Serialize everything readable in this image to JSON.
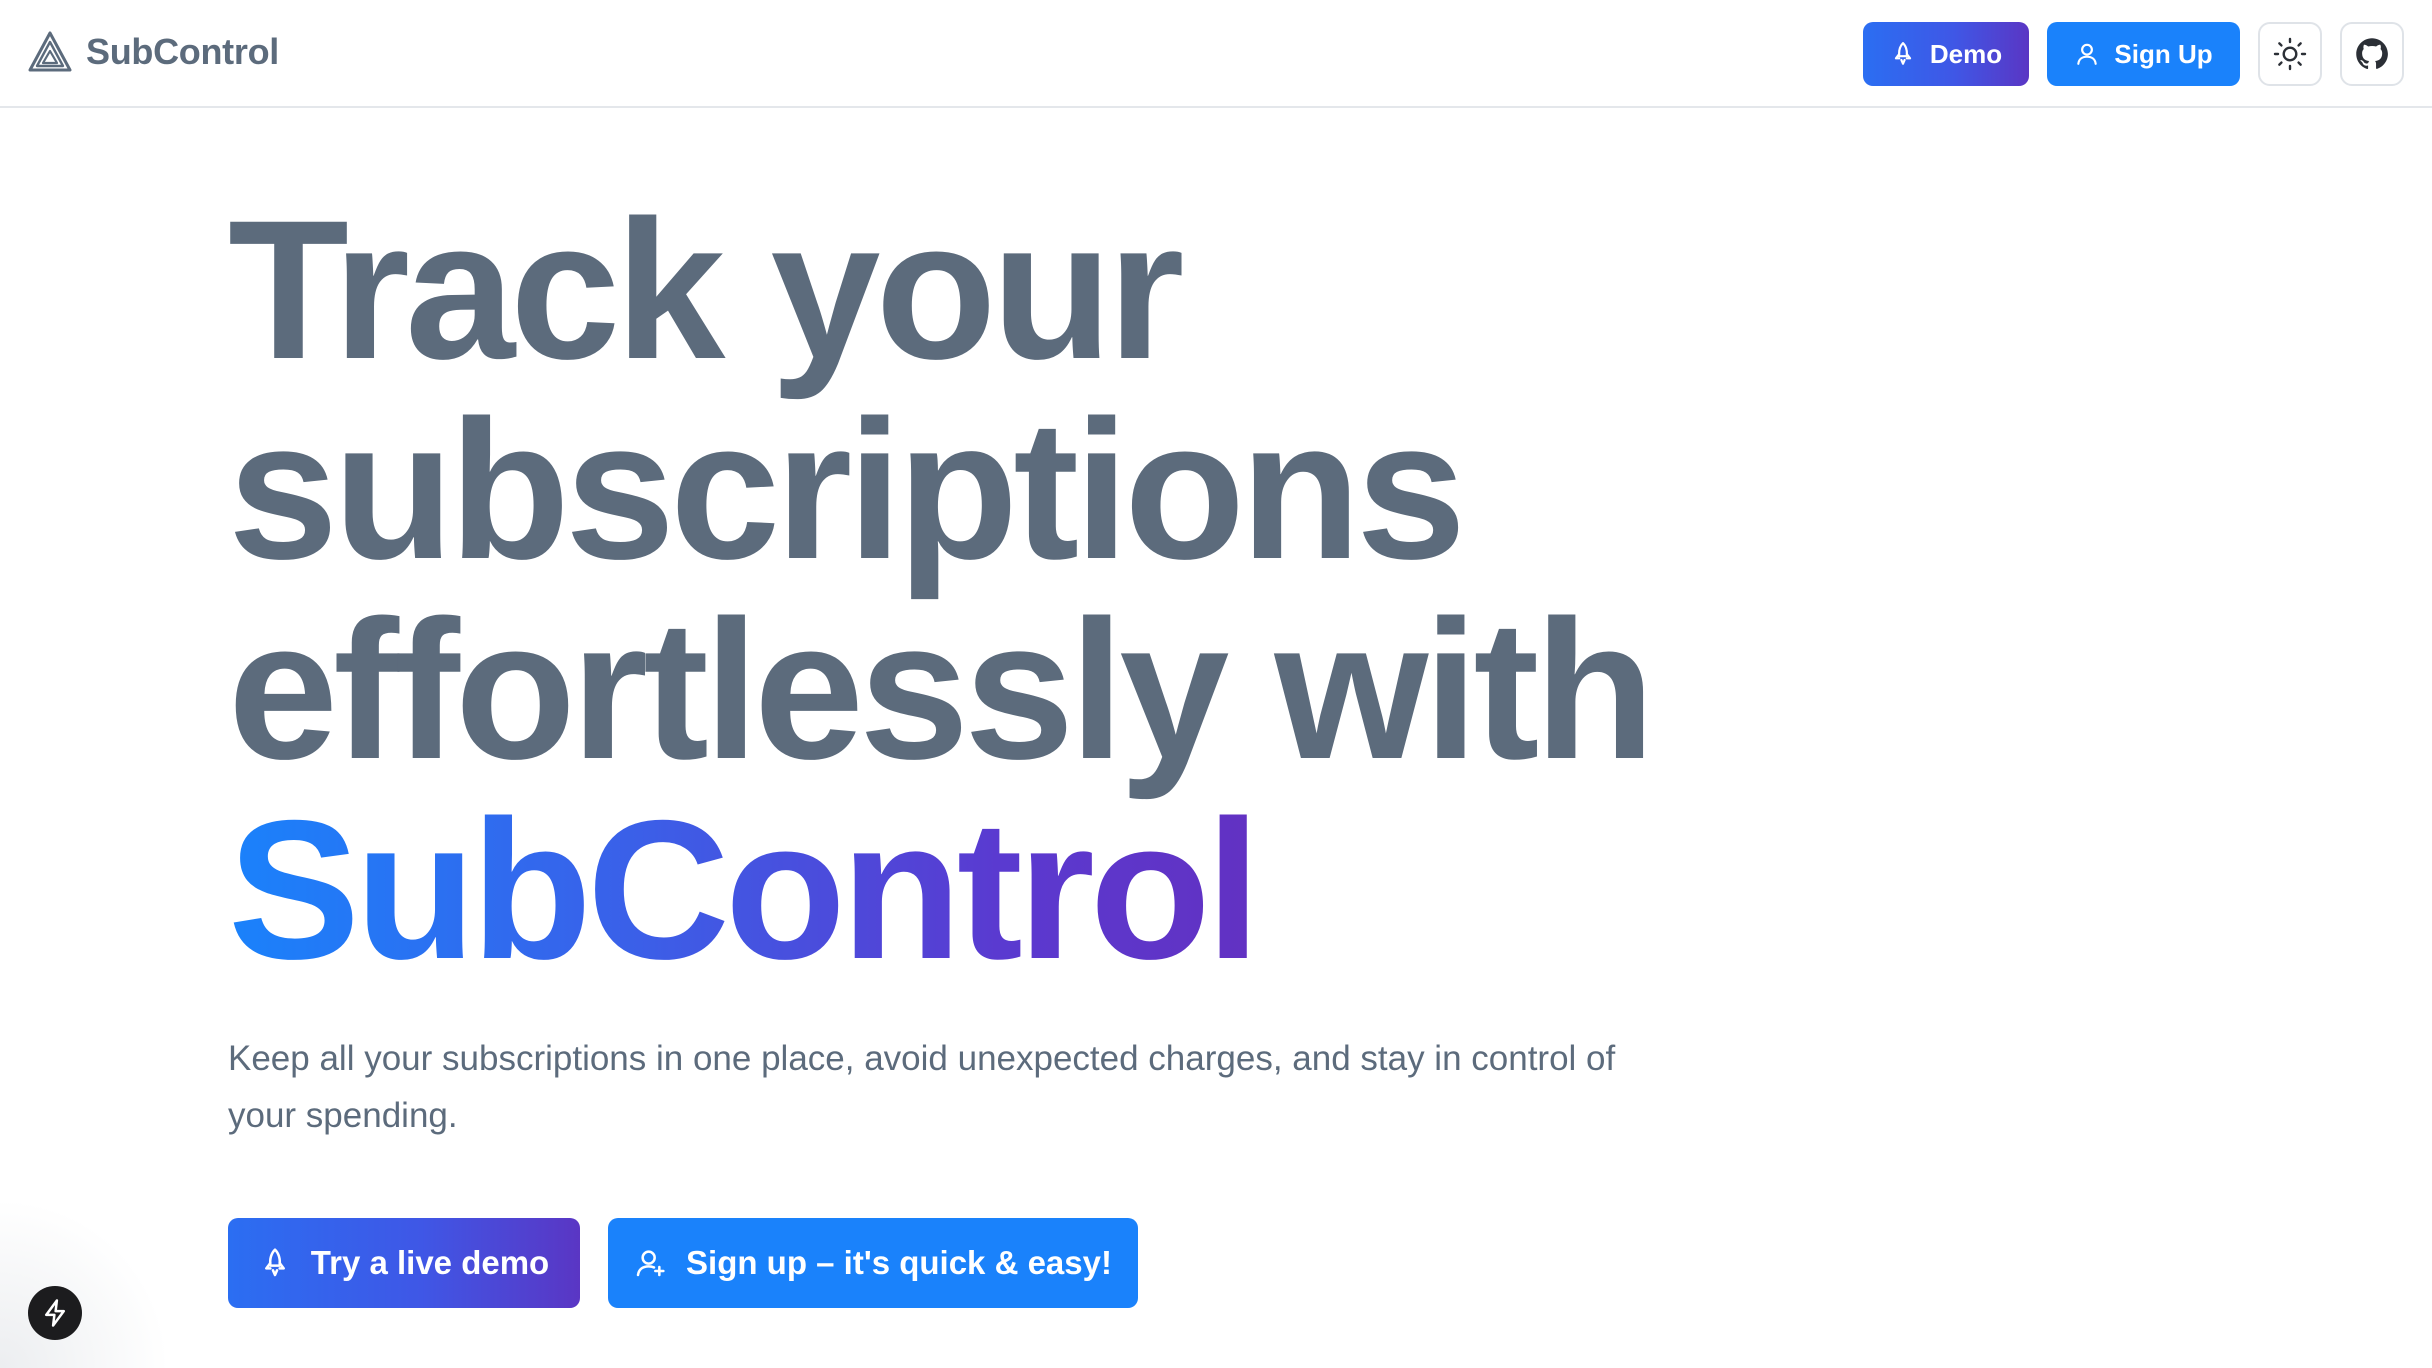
{
  "header": {
    "brand_name": "SubControl",
    "logo_icon": "triangle-logo-icon",
    "demo_label": "Demo",
    "signup_label": "Sign Up",
    "theme_icon": "sun-icon",
    "github_icon": "github-icon"
  },
  "hero": {
    "headline_line1": "Track your",
    "headline_line2": "subscriptions",
    "headline_line3": "effortlessly with",
    "headline_brand": "SubControl",
    "subtitle": "Keep all your subscriptions in one place, avoid unexpected charges, and stay in control of your spending.",
    "cta_demo_label": "Try a live demo",
    "cta_signup_label": "Sign up – it's quick & easy!"
  },
  "colors": {
    "headline_text": "#5c6b7c",
    "accent_blue": "#1a82fb",
    "accent_purple": "#6231c2"
  },
  "corner_badge_icon": "lightning-icon"
}
